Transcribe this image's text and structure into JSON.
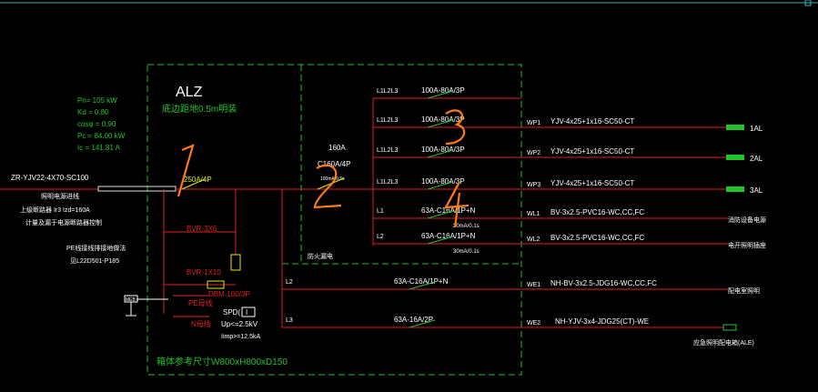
{
  "panel": {
    "title": "ALZ",
    "subtitle": "底边距地0.5m明装",
    "size_note": "箱体参考尺寸W800xH800xD150"
  },
  "params": {
    "pn": "Pn= 105 kW",
    "kd": "Kd = 0.80",
    "cos": "cosφ = 0.90",
    "pc": "Pc = 84.00 kW",
    "ic": "Ic = 141.81 A"
  },
  "incoming": {
    "cable": "ZR-YJV22-4X70-SC100",
    "note1": "照明电源进线",
    "note2": "上级断路器 Ir3 Izd=160A",
    "note3": "计量及漏于电源断路器控制",
    "pe_note": "PE线接线排接地做法",
    "pe_ref": "见L22D501-P185",
    "main_breaker": "250A/4P"
  },
  "left_devices": {
    "bvr1": "BVR-3X6",
    "bvr2": "BVR-1X10",
    "dbm": "DBM-100/3P",
    "pe": "PE母线",
    "n": "N母线",
    "spd": "SPD(",
    "spd_box": "I",
    "up": "Up<=2.5kV",
    "imp": "Iimp>=12.5kA",
    "mb": "MEB"
  },
  "sub": {
    "current": "160A",
    "breaker": "C160A/4P",
    "trip": "100mA/0.5s",
    "label": "防火漏电"
  },
  "circuits": [
    {
      "id": "L1L2L3",
      "breaker": "100A-80A/3P",
      "wp": "",
      "cable": "",
      "dest": ""
    },
    {
      "id": "L1L2L3",
      "breaker": "100A-80A/3P",
      "wp": "WP1",
      "cable": "YJV-4x25+1x16-SC50-CT",
      "dest": "1AL"
    },
    {
      "id": "L1L2L3",
      "breaker": "100A-80A/3P",
      "wp": "WP2",
      "cable": "YJV-4x25+1x16-SC50-CT",
      "dest": "2AL"
    },
    {
      "id": "L1L2L3",
      "breaker": "100A-80A/3P",
      "wp": "WP3",
      "cable": "YJV-4x25+1x16-SC50-CT",
      "dest": "3AL"
    },
    {
      "id": "L1",
      "breaker": "63A-C16A/1P+N",
      "rcd": "30mA/0.1s",
      "wp": "WL1",
      "cable": "BV-3x2.5-PVC16-WC,CC,FC",
      "dest": "消防设备电源"
    },
    {
      "id": "L2",
      "breaker": "63A-C16A/1P+N",
      "rcd": "30mA/0.1s",
      "wp": "WL2",
      "cable": "BV-3x2.5-PVC16-WC,CC,FC",
      "dest": "电开照明插座"
    },
    {
      "id": "L2",
      "breaker": "63A-C16A/1P+N",
      "wp": "WE1",
      "cable": "NH-BV-3x2.5-JDG16-WC,CC,FC",
      "dest": "配电室照明"
    },
    {
      "id": "L3",
      "breaker": "63A-16A/2P",
      "wp": "WE2",
      "cable": "NH-YJV-3x4-JDG25(CT)-WE",
      "dest": "应急照明配电箱(ALE)"
    }
  ],
  "annotations": [
    "1",
    "2",
    "3",
    "4"
  ]
}
